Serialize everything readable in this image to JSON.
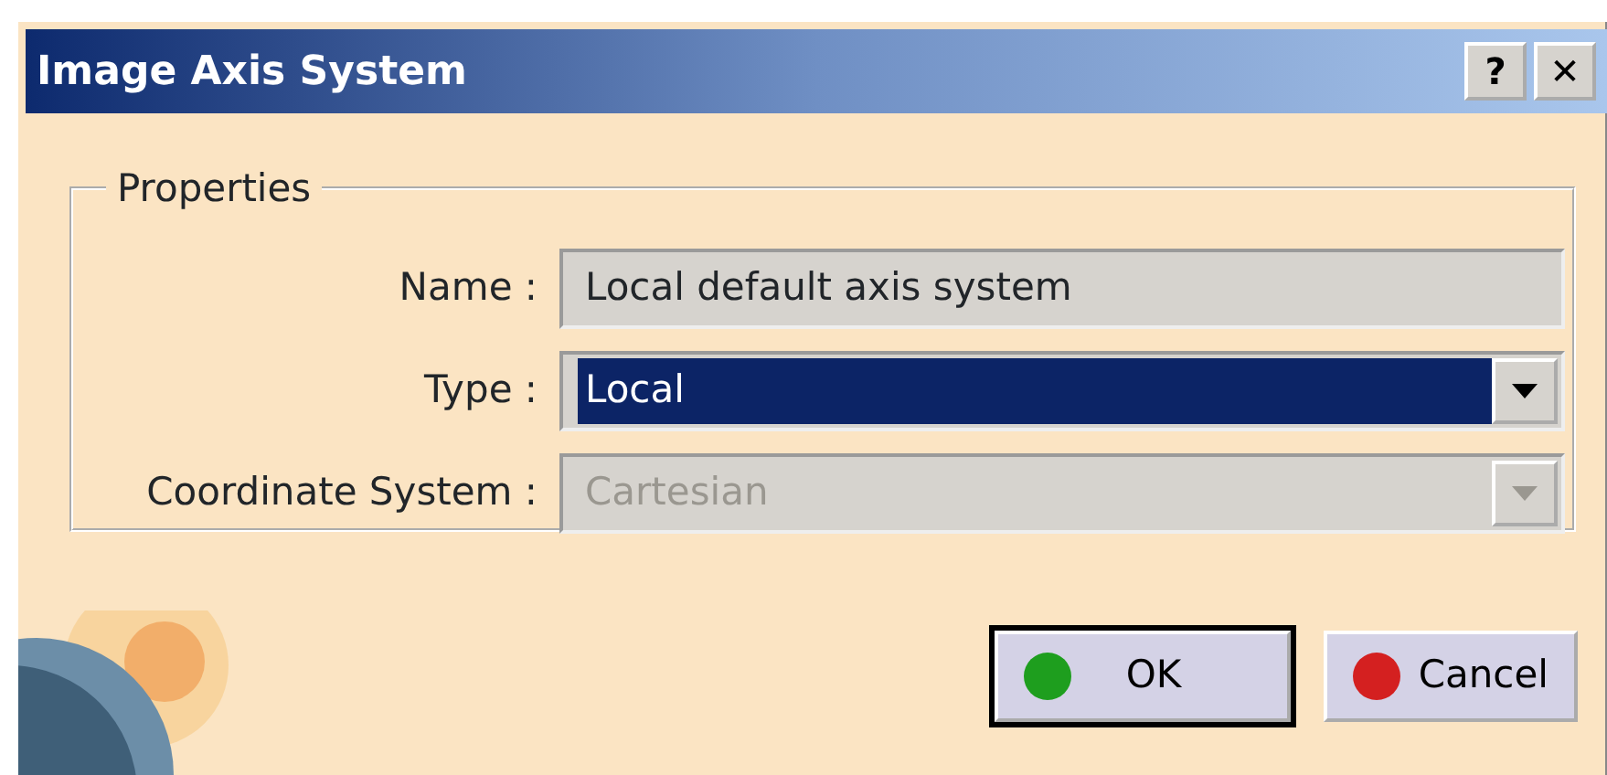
{
  "window": {
    "title": "Image Axis System",
    "title_buttons": [
      "?",
      "✕"
    ]
  },
  "group": {
    "title": "Properties",
    "fields": [
      {
        "kind": "text",
        "label": "Name :",
        "value": "Local default axis system",
        "selected": false,
        "disabled": false
      },
      {
        "kind": "combo",
        "label": "Type :",
        "value": "Local",
        "selected": true,
        "disabled": false
      },
      {
        "kind": "combo",
        "label": "Coordinate System :",
        "value": "Cartesian",
        "selected": false,
        "disabled": true
      }
    ]
  },
  "buttons": [
    {
      "label": "OK",
      "default": true,
      "color": "#1e9e1e"
    },
    {
      "label": "Cancel",
      "default": false,
      "color": "#d42020"
    }
  ]
}
